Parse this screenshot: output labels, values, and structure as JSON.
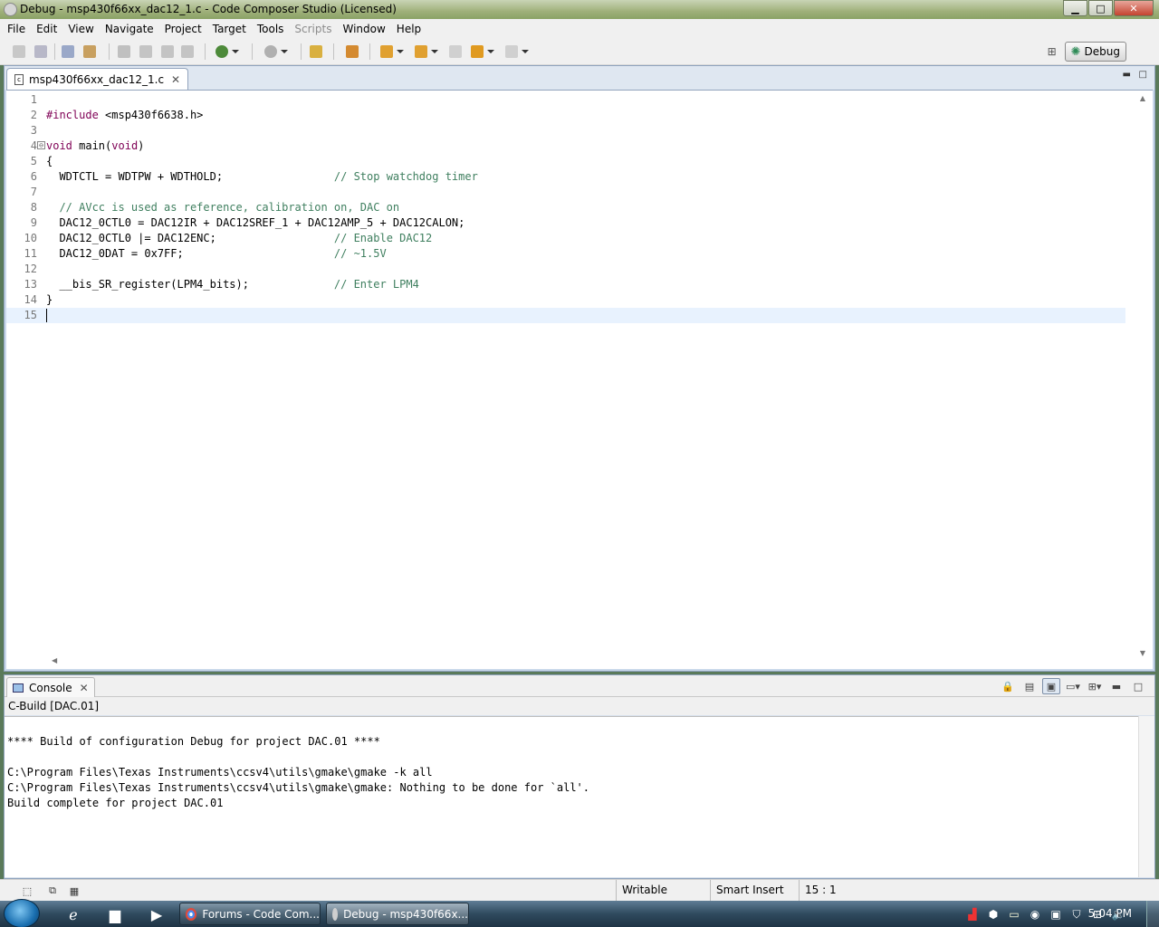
{
  "window": {
    "title": "Debug - msp430f66xx_dac12_1.c - Code Composer Studio (Licensed)",
    "minimize": "▁",
    "maximize": "□",
    "close": "✕"
  },
  "menubar": {
    "items": [
      "File",
      "Edit",
      "View",
      "Navigate",
      "Project",
      "Target",
      "Tools",
      "Scripts",
      "Window",
      "Help"
    ],
    "disabled": [
      "Scripts"
    ]
  },
  "perspective": {
    "label": "Debug"
  },
  "editor": {
    "tab_label": "msp430f66xx_dac12_1.c",
    "lines": [
      {
        "n": "1",
        "parts": []
      },
      {
        "n": "2",
        "parts": [
          {
            "t": "#include",
            "c": "kw"
          },
          {
            "t": " <msp430f6638.h>",
            "c": ""
          }
        ]
      },
      {
        "n": "3",
        "parts": []
      },
      {
        "n": "4",
        "parts": [
          {
            "t": "void",
            "c": "kw"
          },
          {
            "t": " main(",
            "c": ""
          },
          {
            "t": "void",
            "c": "kw"
          },
          {
            "t": ")",
            "c": ""
          }
        ],
        "fold": true
      },
      {
        "n": "5",
        "parts": [
          {
            "t": "{",
            "c": ""
          }
        ]
      },
      {
        "n": "6",
        "parts": [
          {
            "t": "  WDTCTL = WDTPW + WDTHOLD;                 ",
            "c": ""
          },
          {
            "t": "// Stop watchdog timer",
            "c": "cm"
          }
        ]
      },
      {
        "n": "7",
        "parts": []
      },
      {
        "n": "8",
        "parts": [
          {
            "t": "  ",
            "c": ""
          },
          {
            "t": "// AVcc is used as reference, calibration on, DAC on",
            "c": "cm"
          }
        ]
      },
      {
        "n": "9",
        "parts": [
          {
            "t": "  DAC12_0CTL0 = DAC12IR + DAC12SREF_1 + DAC12AMP_5 + DAC12CALON;",
            "c": ""
          }
        ]
      },
      {
        "n": "10",
        "parts": [
          {
            "t": "  DAC12_0CTL0 |= DAC12ENC;                  ",
            "c": ""
          },
          {
            "t": "// Enable DAC12",
            "c": "cm"
          }
        ]
      },
      {
        "n": "11",
        "parts": [
          {
            "t": "  DAC12_0DAT = 0x7FF;                       ",
            "c": ""
          },
          {
            "t": "// ~1.5V",
            "c": "cm"
          }
        ]
      },
      {
        "n": "12",
        "parts": []
      },
      {
        "n": "13",
        "parts": [
          {
            "t": "  __bis_SR_register(LPM4_bits);             ",
            "c": ""
          },
          {
            "t": "// Enter LPM4",
            "c": "cm"
          }
        ]
      },
      {
        "n": "14",
        "parts": [
          {
            "t": "}",
            "c": ""
          }
        ]
      },
      {
        "n": "15",
        "parts": [],
        "current": true
      }
    ]
  },
  "console": {
    "tab_label": "Console",
    "title": "C-Build [DAC.01]",
    "lines": [
      "",
      "**** Build of configuration Debug for project DAC.01 ****",
      "",
      "C:\\Program Files\\Texas Instruments\\ccsv4\\utils\\gmake\\gmake -k all",
      "C:\\Program Files\\Texas Instruments\\ccsv4\\utils\\gmake\\gmake: Nothing to be done for `all'.",
      "Build complete for project DAC.01"
    ]
  },
  "status": {
    "writable": "Writable",
    "insert_mode": "Smart Insert",
    "position": "15 : 1"
  },
  "taskbar": {
    "tasks": [
      "Forums - Code Com...",
      "Debug - msp430f66x..."
    ],
    "clock": "5:04 PM"
  },
  "colors": {
    "keyword": "#7f0055",
    "comment": "#3f7f5f",
    "current_line": "#e8f2fe"
  }
}
